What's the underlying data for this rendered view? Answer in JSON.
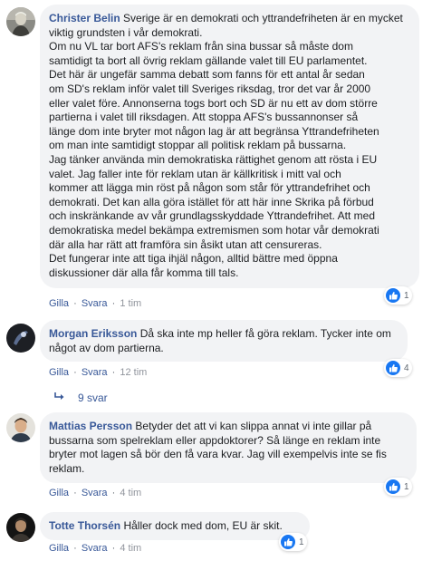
{
  "comments": [
    {
      "author": "Christer Belin",
      "text_first": "Sverige är en demokrati och yttrandefriheten är en mycket viktig grundsten i vår demokrati.",
      "lines": [
        "Om nu VL tar bort AFS's reklam från sina bussar så måste dom",
        "samtidigt ta bort all övrig reklam gällande valet till EU parlamentet.",
        "Det här är ungefär samma debatt som fanns för ett antal år sedan",
        "om SD's reklam inför valet till Sveriges riksdag, tror det var år 2000",
        "eller valet före. Annonserna togs bort och SD är nu ett av dom större",
        "partierna i valet till riksdagen. Att stoppa AFS's bussannonser så",
        "länge dom inte bryter mot någon lag är att begränsa Yttrandefriheten",
        "om man inte samtidigt stoppar all politisk reklam på bussarna.",
        "Jag tänker använda min demokratiska rättighet genom att rösta i EU",
        "valet. Jag faller inte för reklam utan är källkritisk i mitt val och",
        "kommer att lägga min röst på någon som står för yttrandefrihet och",
        "demokrati. Det kan alla göra istället för att här inne Skrika på förbud",
        "och inskränkande av vår grundlagsskyddade Yttrandefrihet. Att med",
        "demokratiska medel bekämpa extremismen som hotar vår demokrati",
        "där alla har rätt att framföra sin åsikt utan att censureras.",
        "Det fungerar inte att tiga ihjäl någon, alltid bättre med öppna",
        "diskussioner där alla får komma till tals."
      ],
      "like": "Gilla",
      "reply": "Svara",
      "time": "1 tim",
      "reactions": "1"
    },
    {
      "author": "Morgan Eriksson",
      "text": "Då ska inte mp heller få göra reklam. Tycker inte om något av dom partierna.",
      "like": "Gilla",
      "reply": "Svara",
      "time": "12 tim",
      "reactions": "4",
      "replies_label": "9 svar"
    },
    {
      "author": "Mattias Persson",
      "text": "Betyder det att vi kan slippa annat vi inte gillar på bussarna som spelreklam eller appdoktorer? Så länge en reklam inte bryter mot lagen så bör den få vara kvar. Jag vill exempelvis inte se fis reklam.",
      "like": "Gilla",
      "reply": "Svara",
      "time": "4 tim",
      "reactions": "1"
    },
    {
      "author": "Totte Thorsén",
      "text": "Håller dock med dom, EU är skit.",
      "like": "Gilla",
      "reply": "Svara",
      "time": "4 tim",
      "reactions": "1"
    }
  ],
  "colors": {
    "link": "#385898",
    "bubble": "#f2f3f5",
    "like_blue": "#1877f2",
    "meta": "#90949c"
  }
}
